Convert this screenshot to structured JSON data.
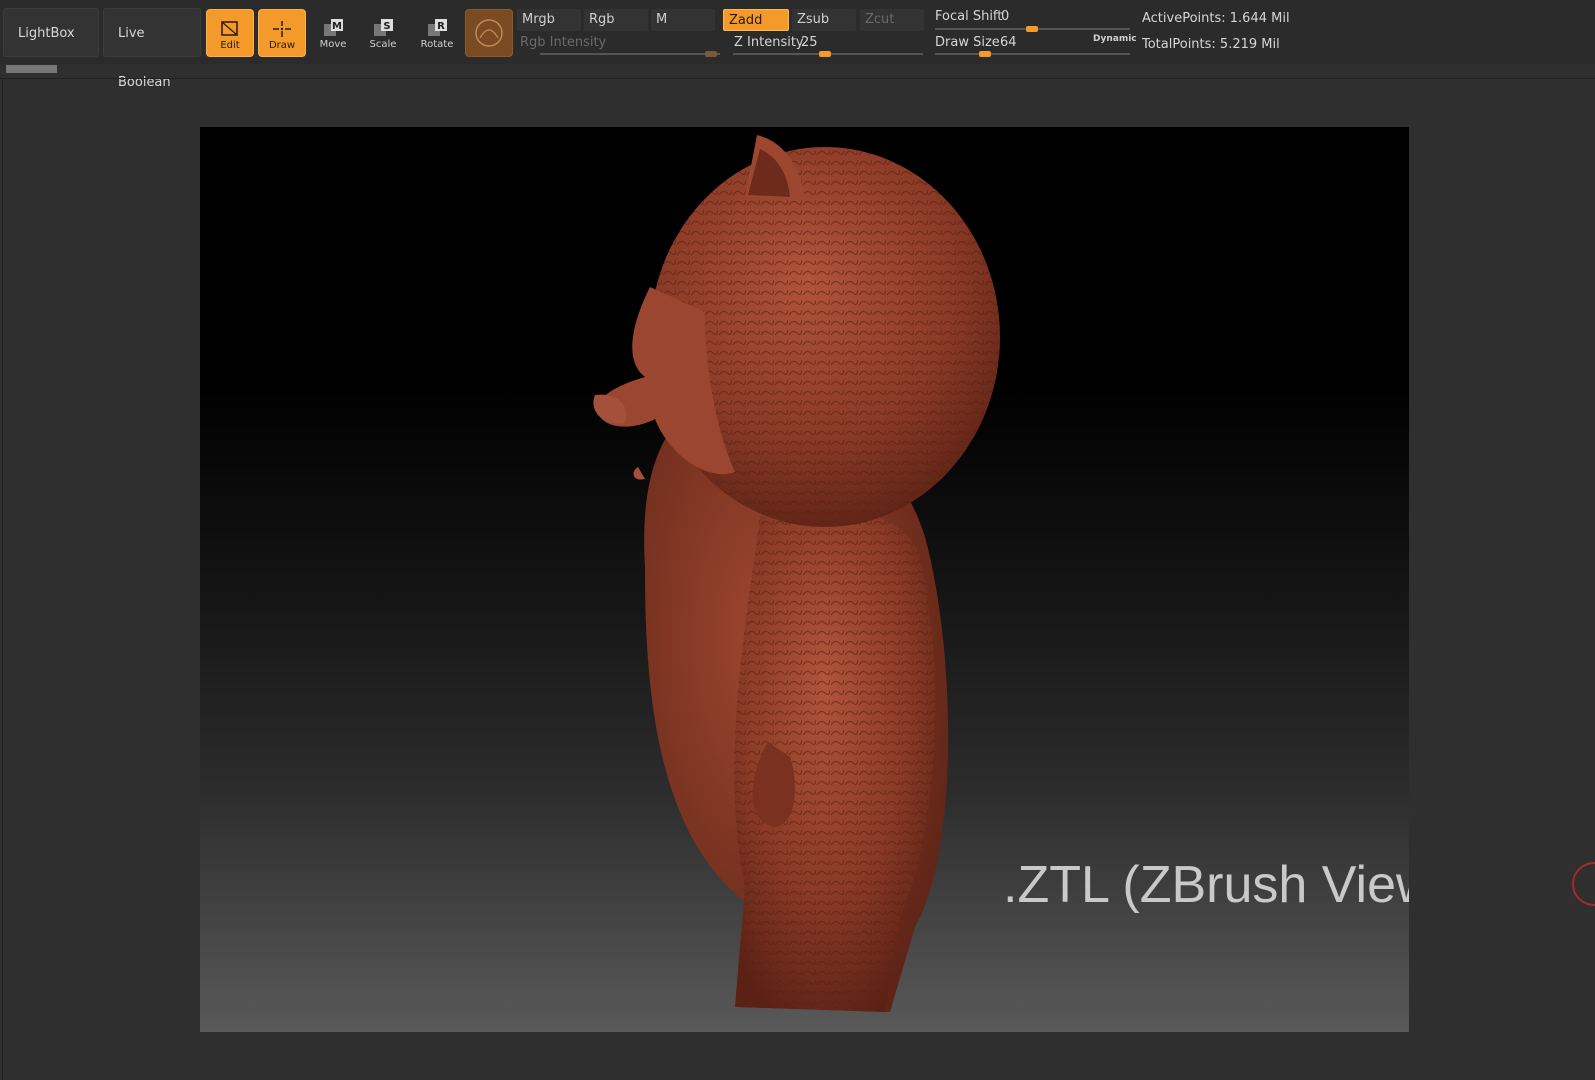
{
  "toolbar": {
    "lightbox": "LightBox",
    "live_boolean": "Live Boolean",
    "tools": [
      {
        "label": "Edit",
        "icon": "edit-icon",
        "active": true
      },
      {
        "label": "Draw",
        "icon": "draw-icon",
        "active": true
      },
      {
        "label": "Move",
        "icon": "move-icon",
        "active": false
      },
      {
        "label": "Scale",
        "icon": "scale-icon",
        "active": false
      },
      {
        "label": "Rotate",
        "icon": "rotate-icon",
        "active": false
      }
    ],
    "material_icon": "material-sphere-icon",
    "modes": {
      "mrgb": "Mrgb",
      "rgb": "Rgb",
      "m": "M",
      "zadd": "Zadd",
      "zsub": "Zsub",
      "zcut": "Zcut"
    },
    "rgb_intensity": {
      "label": "Rgb Intensity",
      "value": ""
    },
    "z_intensity": {
      "label": "Z Intensity",
      "value": "25"
    },
    "focal_shift": {
      "label": "Focal Shift",
      "value": "0"
    },
    "draw_size": {
      "label": "Draw Size",
      "value": "64",
      "dynamic": "Dynamic"
    },
    "active_points": "ActivePoints: 1.644 Mil",
    "total_points": "TotalPoints: 5.219 Mil"
  },
  "viewport": {
    "caption": ".ZTL (ZBrush Viewport)",
    "model_color": "#8a3a26"
  },
  "colors": {
    "accent": "#f39a2b",
    "panel_bg": "#2b2b2b",
    "page_bg": "#2f2f2f"
  }
}
